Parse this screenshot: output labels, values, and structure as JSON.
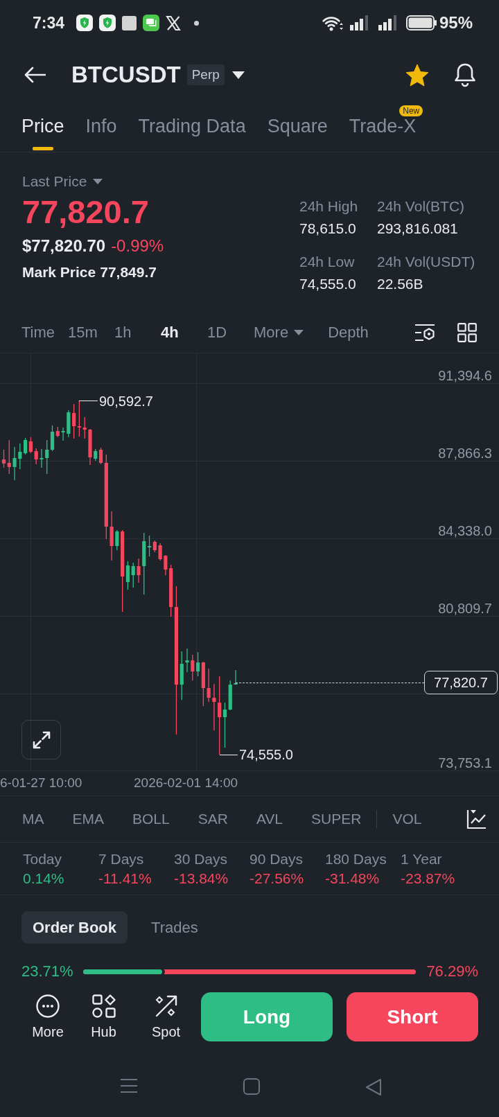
{
  "status_bar": {
    "time": "7:34",
    "battery": "95%"
  },
  "header": {
    "symbol": "BTCUSDT",
    "badge": "Perp",
    "favorite": true
  },
  "tabs": [
    {
      "label": "Price",
      "selected": true
    },
    {
      "label": "Info",
      "selected": false
    },
    {
      "label": "Trading Data",
      "selected": false
    },
    {
      "label": "Square",
      "selected": false
    },
    {
      "label": "Trade-X",
      "selected": false,
      "badge": "New"
    }
  ],
  "price": {
    "label": "Last Price",
    "last": "77,820.7",
    "falling": true,
    "usd": "$77,820.70",
    "change": "-0.99%",
    "mark_label": "Mark Price",
    "mark": "77,849.7",
    "stats": [
      {
        "label": "24h High",
        "value": "78,615.0"
      },
      {
        "label": "24h Vol(BTC)",
        "value": "293,816.081"
      },
      {
        "label": "24h Low",
        "value": "74,555.0"
      },
      {
        "label": "24h Vol(USDT)",
        "value": "22.56B"
      }
    ]
  },
  "intervals": [
    {
      "label": "Time",
      "kind": "option",
      "selected": false
    },
    {
      "label": "15m",
      "kind": "option",
      "selected": false
    },
    {
      "label": "1h",
      "kind": "option",
      "selected": false
    },
    {
      "label": "4h",
      "kind": "option",
      "selected": true
    },
    {
      "label": "1D",
      "kind": "option",
      "selected": false
    },
    {
      "label": "More",
      "kind": "dropdown",
      "selected": false
    },
    {
      "label": "Depth",
      "kind": "option",
      "selected": false
    }
  ],
  "chart": {
    "price_axis": [
      "91,394.6",
      "87,866.3",
      "84,338.0",
      "80,809.7",
      "73,753.1"
    ],
    "high": "90,592.7",
    "low": "74,555.0",
    "last": "77,820.7",
    "time_axis": [
      "6-01-27 10:00",
      "2026-02-01 14:00"
    ]
  },
  "indicators": {
    "main": [
      "MA",
      "EMA",
      "BOLL",
      "SAR",
      "AVL",
      "SUPER"
    ],
    "sub": [
      "VOL"
    ]
  },
  "performance": [
    {
      "period": "Today",
      "change": "0.14%",
      "color": "#2ebd85"
    },
    {
      "period": "7 Days",
      "change": "-11.41%",
      "color": "#f6465d"
    },
    {
      "period": "30 Days",
      "change": "-13.84%",
      "color": "#f6465d"
    },
    {
      "period": "90 Days",
      "change": "-27.56%",
      "color": "#f6465d"
    },
    {
      "period": "180 Days",
      "change": "-31.48%",
      "color": "#f6465d"
    },
    {
      "period": "1 Year",
      "change": "-23.87%",
      "color": "#f6465d"
    }
  ],
  "order_book": {
    "tabs": [
      {
        "label": "Order Book",
        "selected": true
      },
      {
        "label": "Trades",
        "selected": false
      }
    ],
    "buy_share": "23.71%",
    "sell_share": "76.29%",
    "level": 0.2371
  },
  "actions": {
    "shortcuts": [
      {
        "label": "More",
        "kind": "more"
      },
      {
        "label": "Hub",
        "kind": "hub"
      },
      {
        "label": "Spot",
        "kind": "spot"
      }
    ],
    "buttons": [
      {
        "label": "Long",
        "kind": "long"
      },
      {
        "label": "Short",
        "kind": "short"
      }
    ]
  }
}
